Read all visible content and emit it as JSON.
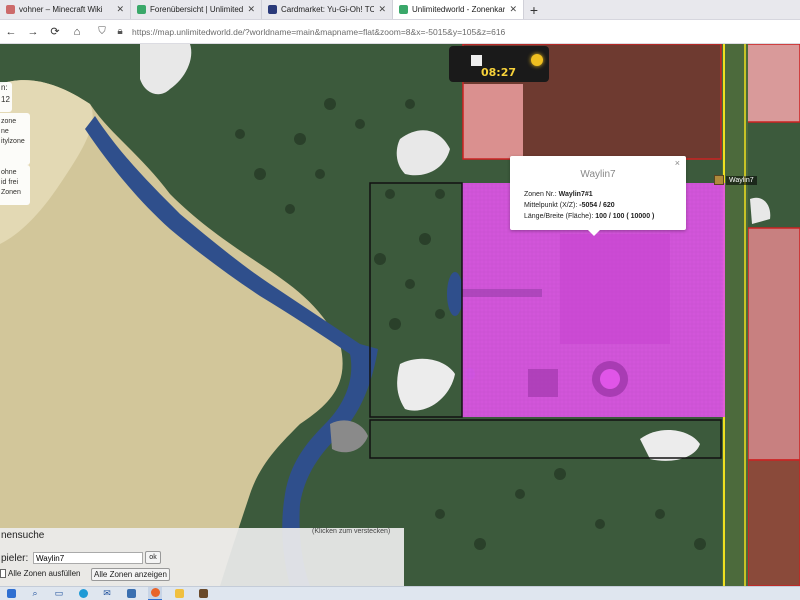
{
  "browser": {
    "tabs": [
      {
        "title": "vohner – Minecraft Wiki",
        "close": "✕",
        "color": "#cc6a6a"
      },
      {
        "title": "Forenübersicht | Unlimitedworld",
        "close": "✕",
        "color": "#3aa86a"
      },
      {
        "title": "Cardmarket: Yu-Gi-Oh! TCG kau",
        "close": "✕",
        "color": "#2a3a7a"
      },
      {
        "title": "Unlimitedworld - Zonenkarte",
        "close": "✕",
        "color": "#3aa86a"
      }
    ],
    "new_tab_label": "+",
    "url": "https://map.unlimitedworld.de/?worldname=main&mapname=flat&zoom=8&x=-5015&y=105&z=616",
    "icons": {
      "back": "arrow-left-icon",
      "forward": "arrow-right-icon",
      "reload": "reload-icon",
      "home": "home-icon",
      "shield": "shield-icon",
      "lock": "lock-icon"
    }
  },
  "map": {
    "clock_time": "08:27",
    "coords_partial": [
      "n:",
      "12"
    ],
    "zone_options_partial": [
      "zone",
      "ne",
      "itylzone"
    ],
    "zone_options2_partial": [
      "ohne",
      "id frei",
      "Zonen"
    ],
    "popup": {
      "title": "Waylin7",
      "close": "×",
      "zone_nr_label": "Zonen Nr.:",
      "zone_nr_value": "Waylin7#1",
      "center_label": "Mittelpunkt (X/Z):",
      "center_value": "-5054 / 620",
      "size_label": "Länge/Breite (Fläche):",
      "size_value": "100 / 100 ( 10000 )"
    },
    "player_name": "Waylin7",
    "colors": {
      "grass": "#3c5a3c",
      "sand": "#d2c69a",
      "water": "#2f4f8c",
      "zone_magenta": "#e055e8",
      "zone_red": "#cc2222",
      "zone_yellow": "#f0e020"
    }
  },
  "search_panel": {
    "title": "nensuche",
    "hide_hint": "(Klicken zum verstecken)",
    "player_label": "pieler:",
    "player_value": "Waylin7",
    "ok_label": "ok",
    "fill_all_label": "Alle Zonen ausfüllen",
    "show_all_label": "Alle Zonen anzeigen"
  },
  "taskbar": {
    "icons": [
      "windows-icon",
      "search-icon",
      "task-view-icon",
      "edge-icon",
      "mail-icon",
      "store-icon",
      "firefox-icon",
      "explorer-icon",
      "minecraft-icon"
    ]
  }
}
